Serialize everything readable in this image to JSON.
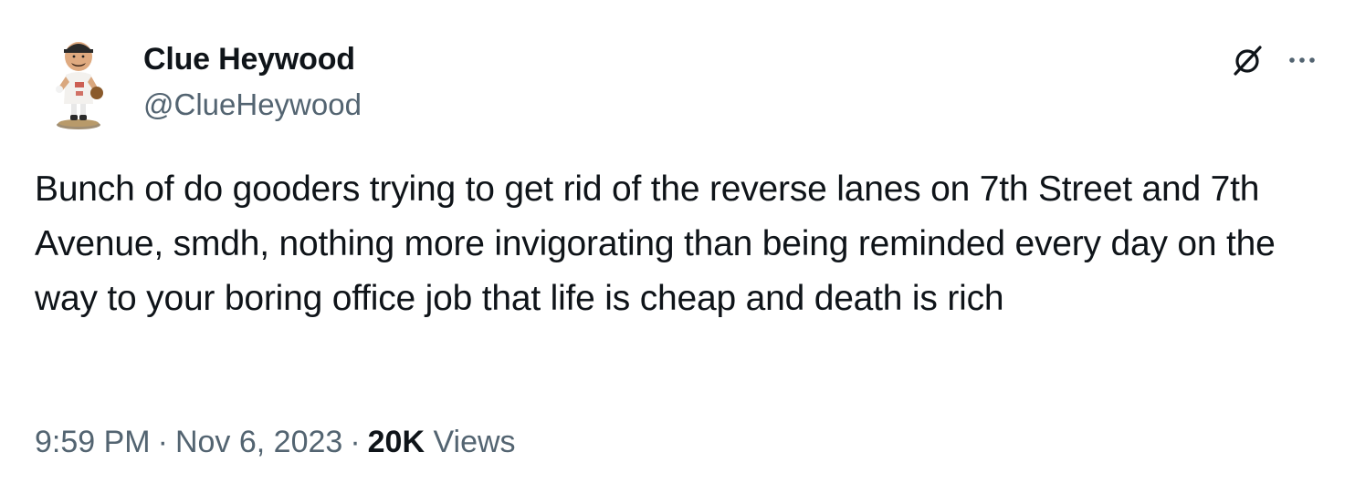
{
  "author": {
    "display_name": "Clue Heywood",
    "handle": "@ClueHeywood",
    "avatar_icon": "bobblehead-baseball-player-avatar"
  },
  "header_actions": {
    "grok_icon": "grok-slash-circle-icon",
    "more_icon": "more-horizontal-icon"
  },
  "tweet": {
    "text": "Bunch of do gooders trying to get rid of the reverse lanes on 7th Street and 7th Avenue, smdh, nothing more invigorating than being reminded every day on the way to your boring office job that life is cheap and death is rich"
  },
  "meta": {
    "time": "9:59 PM",
    "separator": "·",
    "date": "Nov 6, 2023",
    "views_count": "20K",
    "views_label": "Views"
  },
  "colors": {
    "text_primary": "#0f1419",
    "text_secondary": "#536471",
    "background": "#ffffff"
  }
}
